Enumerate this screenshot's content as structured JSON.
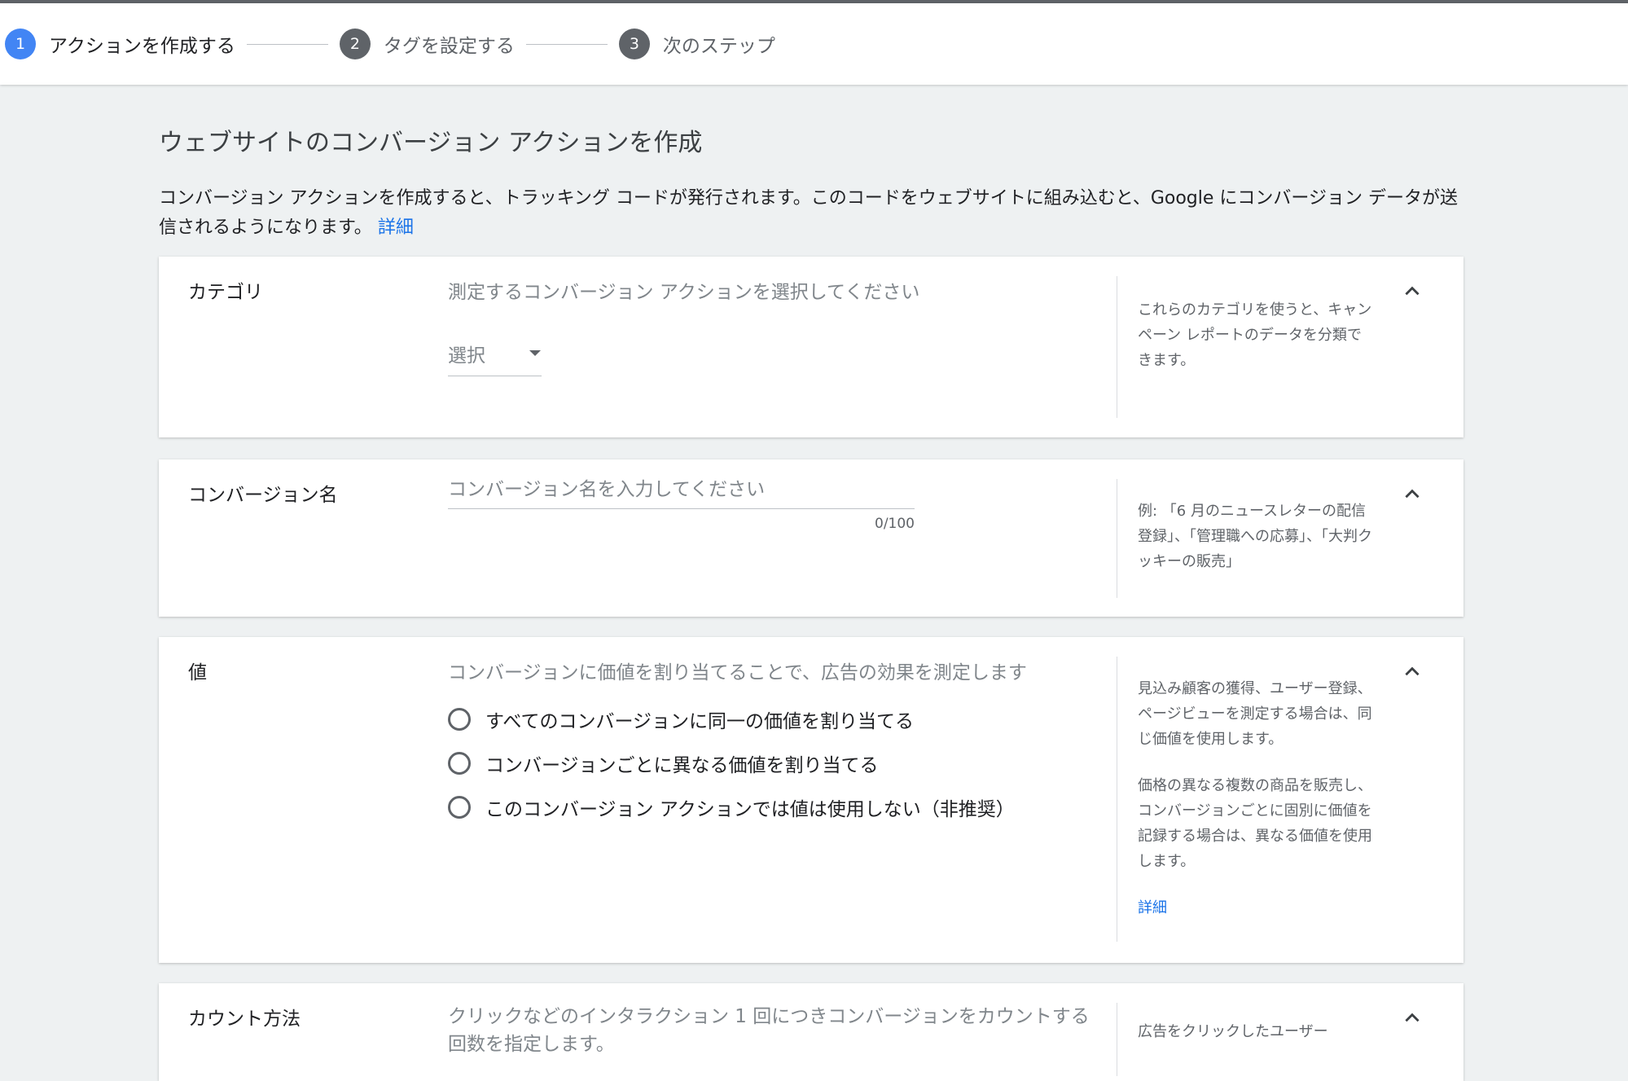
{
  "stepper": {
    "steps": [
      {
        "number": "1",
        "label": "アクションを作成する"
      },
      {
        "number": "2",
        "label": "タグを設定する"
      },
      {
        "number": "3",
        "label": "次のステップ"
      }
    ]
  },
  "page": {
    "title": "ウェブサイトのコンバージョン アクションを作成",
    "description": "コンバージョン アクションを作成すると、トラッキング コードが発行されます。このコードをウェブサイトに組み込むと、Google にコンバージョン データが送信されるようになります。",
    "learn_more": "詳細"
  },
  "category": {
    "label": "カテゴリ",
    "prompt": "測定するコンバージョン アクションを選択してください",
    "select_value": "選択",
    "help": "これらのカテゴリを使うと、キャンペーン レポートのデータを分類できます。"
  },
  "conversion_name": {
    "label": "コンバージョン名",
    "placeholder": "コンバージョン名を入力してください",
    "counter": "0/100",
    "help": "例: 「6 月のニュースレターの配信登録」、「管理職への応募」、「大判クッキーの販売」"
  },
  "value": {
    "label": "値",
    "prompt": "コンバージョンに価値を割り当てることで、広告の効果を測定します",
    "options": [
      "すべてのコンバージョンに同一の価値を割り当てる",
      "コンバージョンごとに異なる価値を割り当てる",
      "このコンバージョン アクションでは値は使用しない（非推奨）"
    ],
    "help_1": "見込み顧客の獲得、ユーザー登録、ページビューを測定する場合は、同じ価値を使用します。",
    "help_2": "価格の異なる複数の商品を販売し、コンバージョンごとに固別に価値を記録する場合は、異なる価値を使用します。",
    "learn_more": "詳細"
  },
  "count": {
    "label": "カウント方法",
    "prompt": "クリックなどのインタラクション 1 回につきコンバージョンをカウントする回数を指定します。",
    "help": "広告をクリックしたユーザー"
  },
  "colors": {
    "accent": "#4285f4",
    "link": "#1a73e8",
    "background": "#eef1f2"
  }
}
